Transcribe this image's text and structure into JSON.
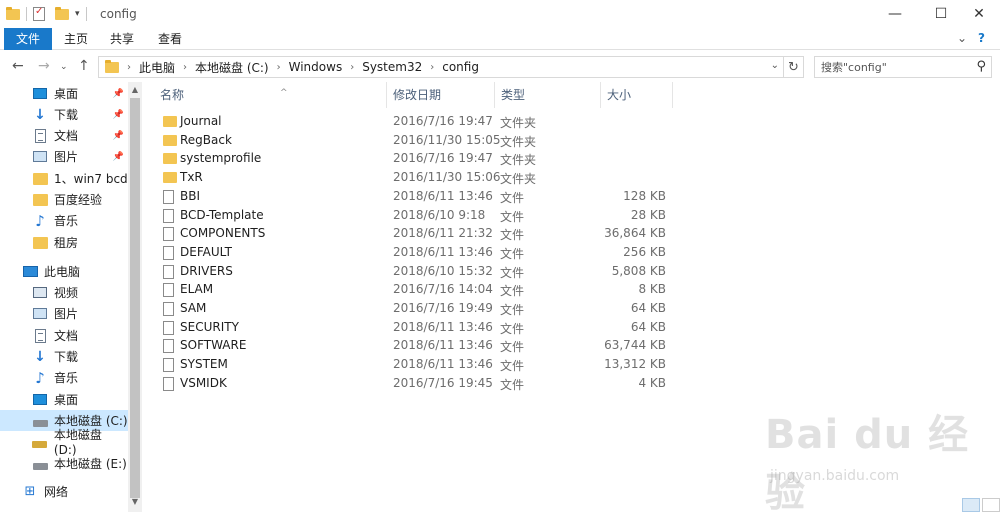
{
  "window": {
    "title": "config",
    "minimize": "—",
    "maximize": "☐",
    "close": "✕"
  },
  "ribbon": {
    "tabs": [
      "文件",
      "主页",
      "共享",
      "查看"
    ],
    "collapse": "⌄",
    "help": "?"
  },
  "address": {
    "crumbs": [
      "此电脑",
      "本地磁盘 (C:)",
      "Windows",
      "System32",
      "config"
    ],
    "search_placeholder": "搜索\"config\""
  },
  "nav": {
    "quick_access": [
      {
        "label": "桌面",
        "icon": "desktop-icon",
        "pinned": true
      },
      {
        "label": "下载",
        "icon": "download-icon",
        "pinned": true
      },
      {
        "label": "文档",
        "icon": "document-icon",
        "pinned": true
      },
      {
        "label": "图片",
        "icon": "picture-icon",
        "pinned": true
      },
      {
        "label": "1、win7 bcd",
        "icon": "folder-icon",
        "pinned": false
      },
      {
        "label": "百度经验",
        "icon": "folder-icon",
        "pinned": false
      },
      {
        "label": "音乐",
        "icon": "music-icon",
        "pinned": false
      },
      {
        "label": "租房",
        "icon": "folder-icon",
        "pinned": false
      }
    ],
    "this_pc": "此电脑",
    "pc_items": [
      {
        "label": "视频",
        "icon": "video-icon"
      },
      {
        "label": "图片",
        "icon": "picture-icon"
      },
      {
        "label": "文档",
        "icon": "document-icon"
      },
      {
        "label": "下载",
        "icon": "download-icon"
      },
      {
        "label": "音乐",
        "icon": "music-icon"
      },
      {
        "label": "桌面",
        "icon": "desktop-icon"
      },
      {
        "label": "本地磁盘 (C:)",
        "icon": "drive-c-icon",
        "selected": true
      },
      {
        "label": "本地磁盘 (D:)",
        "icon": "drive-d-icon"
      },
      {
        "label": "本地磁盘 (E:)",
        "icon": "drive-e-icon"
      }
    ],
    "network": "网络"
  },
  "columns": {
    "name": "名称",
    "date": "修改日期",
    "type": "类型",
    "size": "大小"
  },
  "files": [
    {
      "name": "Journal",
      "date": "2016/7/16 19:47",
      "type": "文件夹",
      "size": "",
      "kind": "folder"
    },
    {
      "name": "RegBack",
      "date": "2016/11/30 15:05",
      "type": "文件夹",
      "size": "",
      "kind": "folder"
    },
    {
      "name": "systemprofile",
      "date": "2016/7/16 19:47",
      "type": "文件夹",
      "size": "",
      "kind": "folder"
    },
    {
      "name": "TxR",
      "date": "2016/11/30 15:06",
      "type": "文件夹",
      "size": "",
      "kind": "folder"
    },
    {
      "name": "BBI",
      "date": "2018/6/11 13:46",
      "type": "文件",
      "size": "128 KB",
      "kind": "file"
    },
    {
      "name": "BCD-Template",
      "date": "2018/6/10 9:18",
      "type": "文件",
      "size": "28 KB",
      "kind": "file"
    },
    {
      "name": "COMPONENTS",
      "date": "2018/6/11 21:32",
      "type": "文件",
      "size": "36,864 KB",
      "kind": "file"
    },
    {
      "name": "DEFAULT",
      "date": "2018/6/11 13:46",
      "type": "文件",
      "size": "256 KB",
      "kind": "file"
    },
    {
      "name": "DRIVERS",
      "date": "2018/6/10 15:32",
      "type": "文件",
      "size": "5,808 KB",
      "kind": "file"
    },
    {
      "name": "ELAM",
      "date": "2016/7/16 14:04",
      "type": "文件",
      "size": "8 KB",
      "kind": "file"
    },
    {
      "name": "SAM",
      "date": "2016/7/16 19:49",
      "type": "文件",
      "size": "64 KB",
      "kind": "file"
    },
    {
      "name": "SECURITY",
      "date": "2018/6/11 13:46",
      "type": "文件",
      "size": "64 KB",
      "kind": "file"
    },
    {
      "name": "SOFTWARE",
      "date": "2018/6/11 13:46",
      "type": "文件",
      "size": "63,744 KB",
      "kind": "file"
    },
    {
      "name": "SYSTEM",
      "date": "2018/6/11 13:46",
      "type": "文件",
      "size": "13,312 KB",
      "kind": "file"
    },
    {
      "name": "VSMIDK",
      "date": "2016/7/16 19:45",
      "type": "文件",
      "size": "4 KB",
      "kind": "file"
    }
  ],
  "watermark": {
    "logo": "Bai du 经验",
    "url": "jingyan.baidu.com"
  },
  "colors": {
    "accent": "#1979ca",
    "selection": "#cce8ff",
    "folder": "#f3c552"
  }
}
